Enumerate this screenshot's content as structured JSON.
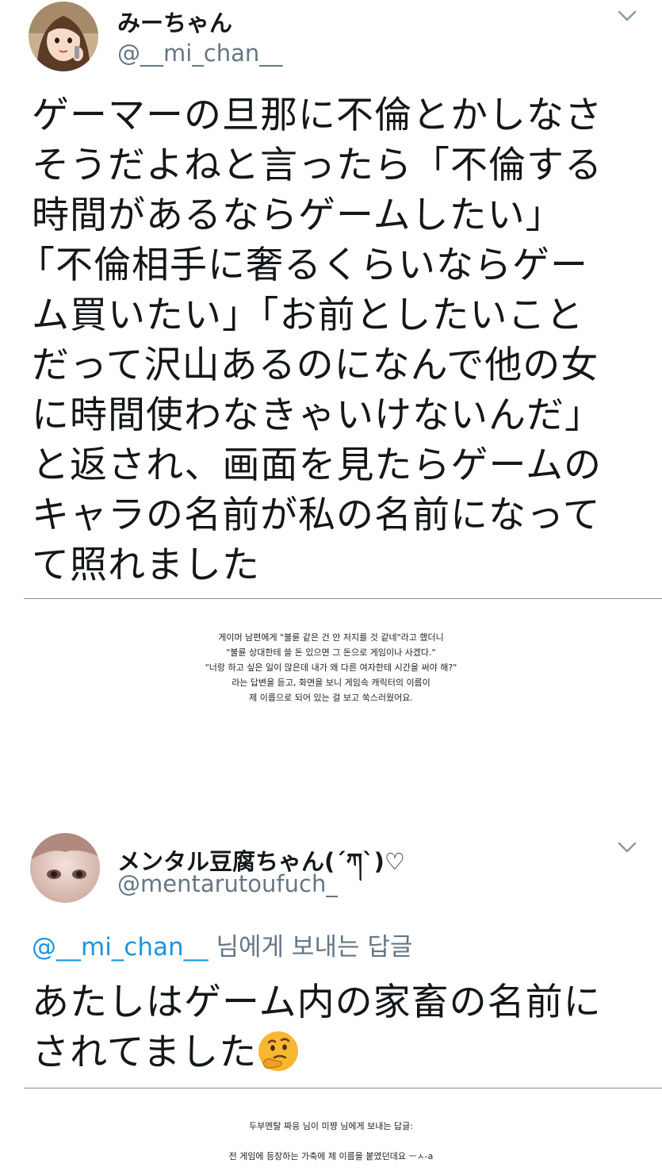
{
  "tweet1": {
    "display_name": "みーちゃん",
    "handle": "@__mi_chan__",
    "avatar_icon": "woman-illustration-avatar",
    "menu_icon": "chevron-down-icon",
    "body_lines": [
      "ゲーマーの旦那に不倫とかしなさ",
      "そうだよねと言ったら「不倫する",
      "時間があるならゲームしたい」",
      "「不倫相手に奢るくらいならゲー",
      "ム買いたい」「お前としたいこと",
      "だって沢山あるのになんで他の女",
      "に時間使わなきゃいけないんだ」",
      "と返され、画面を見たらゲームの",
      "キャラの名前が私の名前になって",
      "て照れました"
    ]
  },
  "caption1": {
    "lines": [
      "게이머 남편에게 \"불륜 같은 건 안 저지를 것 같네\"라고 했더니",
      "\"불륜 상대한테 쓸 돈 있으면 그 돈으로 게임이나 사겠다.\"",
      "\"너랑 하고 싶은 일이 많은데 내가 왜 다른 여자한테 시간을 써야 해?\"",
      "라는 답변을 듣고, 화면을 보니 게임속 캐릭터의 이름이",
      "제 이름으로 되어 있는 걸 보고 쑥스러웠어요."
    ]
  },
  "tweet2": {
    "display_name": "メンタル豆腐ちゃん(´ཀ`)♡",
    "handle": "@mentarutoufuch_",
    "avatar_icon": "photo-avatar",
    "menu_icon": "chevron-down-icon",
    "reply_mention": "@__mi_chan__",
    "reply_suffix": " 님에게 보내는 답글",
    "body_line1": "あたしはゲーム内の家畜の名前に",
    "body_line2": "されてました",
    "emoji": "thinking-face-emoji"
  },
  "caption2": {
    "line1": "두부멘탈 짜응 님이 미쨩 님에게 보내는 답글:",
    "line2": "전 게임에 등장하는 가축에 제 이름을 붙였던데요 ㅡㅅ-a"
  },
  "colors": {
    "text": "#14171a",
    "secondary": "#657786",
    "link": "#1b95e0"
  }
}
